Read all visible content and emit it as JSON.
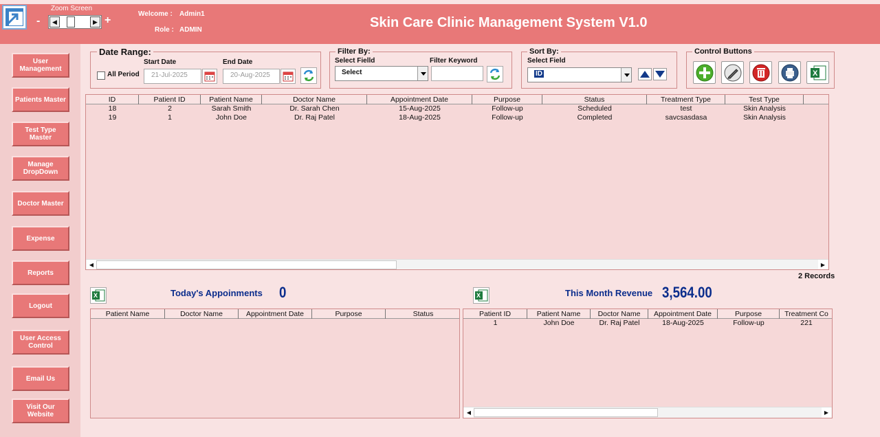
{
  "header": {
    "zoom_label": "Zoom Screen",
    "zoom_minus": "-",
    "zoom_plus": "+",
    "welcome_label": "Welcome :",
    "welcome_user": "Admin1",
    "role_label": "Role :",
    "role_value": "ADMIN",
    "title": "Skin Care Clinic Management System V1.0",
    "color": "#e87878"
  },
  "sidebar": {
    "items": [
      {
        "label": "User Management"
      },
      {
        "label": "Patients Master"
      },
      {
        "label": "Test Type Master"
      },
      {
        "label": "Manage DropDown"
      },
      {
        "label": "Doctor Master"
      },
      {
        "label": "Expense"
      },
      {
        "label": "Reports"
      },
      {
        "label": "Logout"
      },
      {
        "label": "User Access Control"
      },
      {
        "label": "Email Us"
      },
      {
        "label": "Visit Our Website"
      }
    ]
  },
  "date_range": {
    "title": "Date Range:",
    "all_period_label": "All Period",
    "all_period_checked": false,
    "start_label": "Start Date",
    "start_value": "21-Jul-2025",
    "end_label": "End Date",
    "end_value": "20-Aug-2025"
  },
  "filter": {
    "title": "Filter By:",
    "field_label": "Select Fielld",
    "field_value": "Select",
    "keyword_label": "Filter Keyword",
    "keyword_value": ""
  },
  "sort": {
    "title": "Sort By:",
    "field_label": "Select Field",
    "field_value": "ID"
  },
  "control": {
    "title": "Control Buttons",
    "buttons": [
      "add-icon",
      "edit-icon",
      "delete-icon",
      "print-icon",
      "excel-icon"
    ]
  },
  "main_grid": {
    "columns": [
      "ID",
      "Patient ID",
      "Patient Name",
      "Doctor Name",
      "Appointment Date",
      "Purpose",
      "Status",
      "Treatment Type",
      "Test Type"
    ],
    "rows": [
      [
        "18",
        "2",
        "Sarah Smith",
        "Dr. Sarah Chen",
        "15-Aug-2025",
        "Follow-up",
        "Scheduled",
        "test",
        "Skin Analysis"
      ],
      [
        "19",
        "1",
        "John Doe",
        "Dr. Raj Patel",
        "18-Aug-2025",
        "Follow-up",
        "Completed",
        "savcsasdasa",
        "Skin Analysis"
      ]
    ],
    "records_text": "2 Records"
  },
  "today": {
    "label": "Today's Appoinments",
    "count": "0",
    "columns": [
      "Patient Name",
      "Doctor Name",
      "Appointment Date",
      "Purpose",
      "Status"
    ],
    "rows": []
  },
  "revenue": {
    "label": "This Month Revenue",
    "value": "3,564.00",
    "columns": [
      "Patient ID",
      "Patient Name",
      "Doctor Name",
      "Appointment Date",
      "Purpose",
      "Treatment Co"
    ],
    "rows": [
      [
        "1",
        "John Doe",
        "Dr. Raj Patel",
        "18-Aug-2025",
        "Follow-up",
        "221"
      ]
    ]
  },
  "colors": {
    "accent": "#e87878",
    "background": "#f9e3e3",
    "grid_bg": "#f6d8d8",
    "summary_text": "#0b2d8c"
  }
}
